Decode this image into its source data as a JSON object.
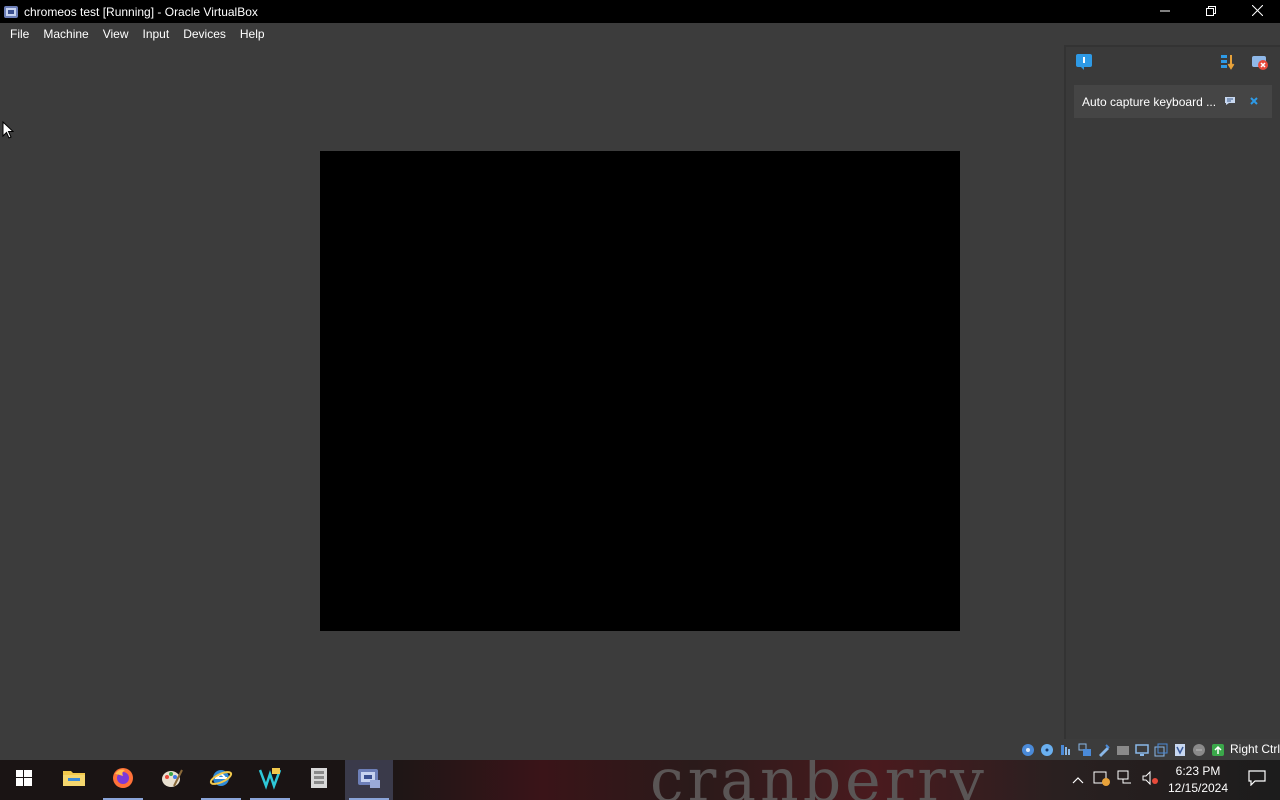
{
  "window": {
    "title": "chromeos test [Running] - Oracle VirtualBox",
    "controls": [
      "minimize-icon",
      "restore-icon",
      "close-icon"
    ]
  },
  "menubar": {
    "items": [
      "File",
      "Machine",
      "View",
      "Input",
      "Devices",
      "Help"
    ]
  },
  "notification_panel": {
    "notice_text": "Auto capture keyboard ...",
    "toolbar_icons": [
      "message-center-icon",
      "sort-icon",
      "clear-all-icon"
    ]
  },
  "statusbar": {
    "host_key": "Right Ctrl",
    "icons": [
      "hard-disk-icon",
      "optical-drive-icon",
      "audio-icon",
      "network-icon",
      "usb-icon",
      "shared-folders-icon",
      "display-icon",
      "recording-icon",
      "cpu-icon",
      "mouse-integration-icon",
      "keyboard-icon"
    ]
  },
  "taskbar": {
    "apps": [
      "start-icon",
      "file-explorer-icon",
      "firefox-icon",
      "paint-icon",
      "internet-explorer-icon",
      "vs-icon",
      "archive-icon",
      "virtualbox-icon"
    ],
    "clock_time": "6:23 PM",
    "clock_date": "12/15/2024",
    "watermark": "cranberry"
  },
  "colors": {
    "background": "#3c3c3c",
    "titlebar": "#000000",
    "vm_screen": "#000000",
    "accent_blue": "#2e9ae6"
  }
}
